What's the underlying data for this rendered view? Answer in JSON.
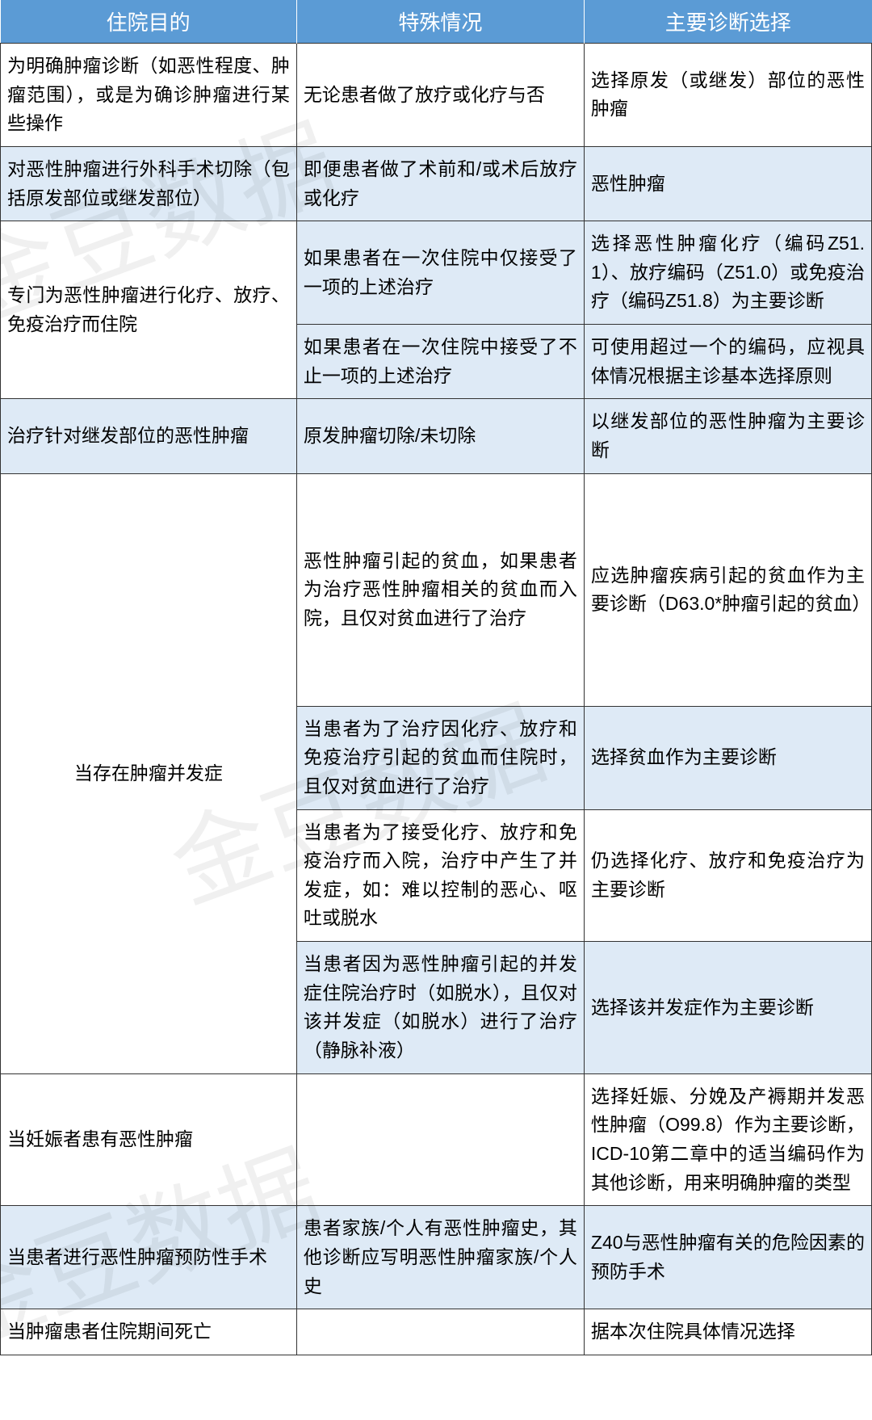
{
  "headers": {
    "col1": "住院目的",
    "col2": "特殊情况",
    "col3": "主要诊断选择"
  },
  "rows": {
    "r1": {
      "purpose": "为明确肿瘤诊断（如恶性程度、肿瘤范围），或是为确诊肿瘤进行某些操作",
      "special": "无论患者做了放疗或化疗与否",
      "diagnosis": "选择原发（或继发）部位的恶性肿瘤"
    },
    "r2": {
      "purpose": "对恶性肿瘤进行外科手术切除（包括原发部位或继发部位）",
      "special": "即便患者做了术前和/或术后放疗或化疗",
      "diagnosis": "恶性肿瘤"
    },
    "r3": {
      "purpose": "专门为恶性肿瘤进行化疗、放疗、免疫治疗而住院",
      "special_a": "如果患者在一次住院中仅接受了一项的上述治疗",
      "diagnosis_a": "选择恶性肿瘤化疗（编码Z51.1）、放疗编码（Z51.0）或免疫治疗（编码Z51.8）为主要诊断",
      "special_b": "如果患者在一次住院中接受了不止一项的上述治疗",
      "diagnosis_b": "可使用超过一个的编码，应视具体情况根据主诊基本选择原则"
    },
    "r4": {
      "purpose": "治疗针对继发部位的恶性肿瘤",
      "special": "原发肿瘤切除/未切除",
      "diagnosis": "以继发部位的恶性肿瘤为主要诊断"
    },
    "r5": {
      "purpose": "当存在肿瘤并发症",
      "special_a": "恶性肿瘤引起的贫血，如果患者为治疗恶性肿瘤相关的贫血而入院，且仅对贫血进行了治疗",
      "diagnosis_a": "应选肿瘤疾病引起的贫血作为主要诊断（D63.0*肿瘤引起的贫血）",
      "special_b": "当患者为了治疗因化疗、放疗和免疫治疗引起的贫血而住院时，且仅对贫血进行了治疗",
      "diagnosis_b": "选择贫血作为主要诊断",
      "special_c": "当患者为了接受化疗、放疗和免疫治疗而入院，治疗中产生了并发症，如：难以控制的恶心、呕吐或脱水",
      "diagnosis_c": "仍选择化疗、放疗和免疫治疗为主要诊断",
      "special_d": "当患者因为恶性肿瘤引起的并发症住院治疗时（如脱水），且仅对该并发症（如脱水）进行了治疗（静脉补液）",
      "diagnosis_d": "选择该并发症作为主要诊断"
    },
    "r6": {
      "purpose": "当妊娠者患有恶性肿瘤",
      "special": "",
      "diagnosis": "选择妊娠、分娩及产褥期并发恶性肿瘤（O99.8）作为主要诊断，ICD-10第二章中的适当编码作为其他诊断，用来明确肿瘤的类型"
    },
    "r7": {
      "purpose": "当患者进行恶性肿瘤预防性手术",
      "special": "患者家族/个人有恶性肿瘤史，其他诊断应写明恶性肿瘤家族/个人史",
      "diagnosis": "Z40与恶性肿瘤有关的危险因素的预防手术"
    },
    "r8": {
      "purpose": "当肿瘤患者住院期间死亡",
      "special": "",
      "diagnosis": "据本次住院具体情况选择"
    }
  }
}
